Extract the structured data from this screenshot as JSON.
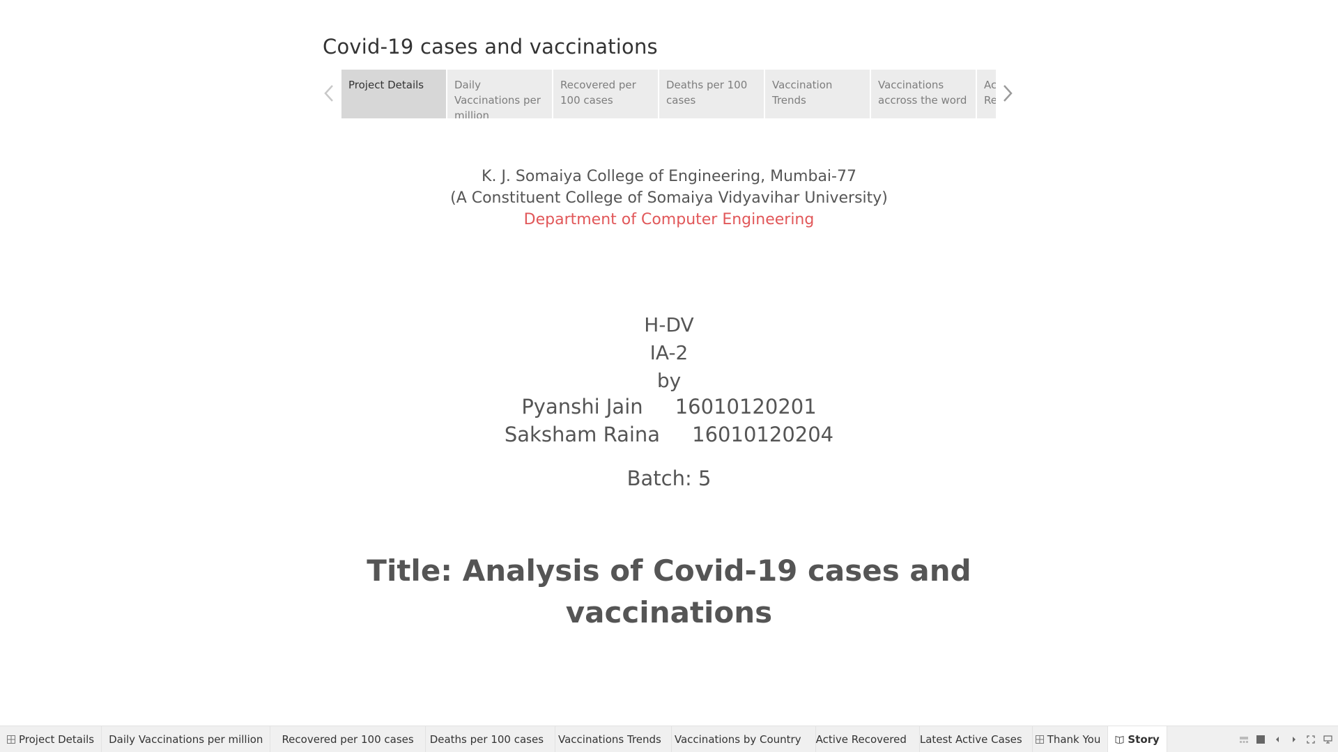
{
  "story": {
    "title": "Covid-19 cases and vaccinations",
    "points": [
      {
        "label": "Project Details",
        "active": true
      },
      {
        "label": "Daily Vaccinations per million",
        "active": false
      },
      {
        "label": "Recovered per 100 cases",
        "active": false
      },
      {
        "label": "Deaths per 100 cases",
        "active": false
      },
      {
        "label": "Vaccination Trends",
        "active": false
      },
      {
        "label": "Vaccinations accross the word",
        "active": false
      },
      {
        "label": "Active Recovered",
        "active": false
      }
    ]
  },
  "content": {
    "college": "K. J. Somaiya College of Engineering, Mumbai-77",
    "constituent": "(A Constituent College of Somaiya Vidyavihar University)",
    "department": "Department of Computer Engineering",
    "course": "H-DV",
    "assessment": "IA-2",
    "by": "by",
    "student1": "Pyanshi Jain     16010120201",
    "student2": "Saksham Raina     16010120204",
    "batch": "Batch: 5",
    "title_line1": "Title: Analysis of Covid-19 cases and",
    "title_line2": "vaccinations"
  },
  "tabs": [
    {
      "label": "Project Details",
      "icon": "dashboard-icon"
    },
    {
      "label": "Daily Vaccinations per million",
      "icon": ""
    },
    {
      "label": "Recovered per 100 cases",
      "icon": ""
    },
    {
      "label": "Deaths per 100 cases",
      "icon": ""
    },
    {
      "label": "Vaccinations Trends",
      "icon": ""
    },
    {
      "label": "Vaccinations by Country",
      "icon": ""
    },
    {
      "label": "Active Recovered",
      "icon": ""
    },
    {
      "label": "Latest Active Cases",
      "icon": ""
    },
    {
      "label": "Thank You",
      "icon": "dashboard-icon"
    },
    {
      "label": "Story",
      "icon": "story-icon"
    }
  ],
  "colors": {
    "accent_red": "#e15759",
    "active_point_bg": "#d7d7d7",
    "point_bg": "#ececec"
  }
}
